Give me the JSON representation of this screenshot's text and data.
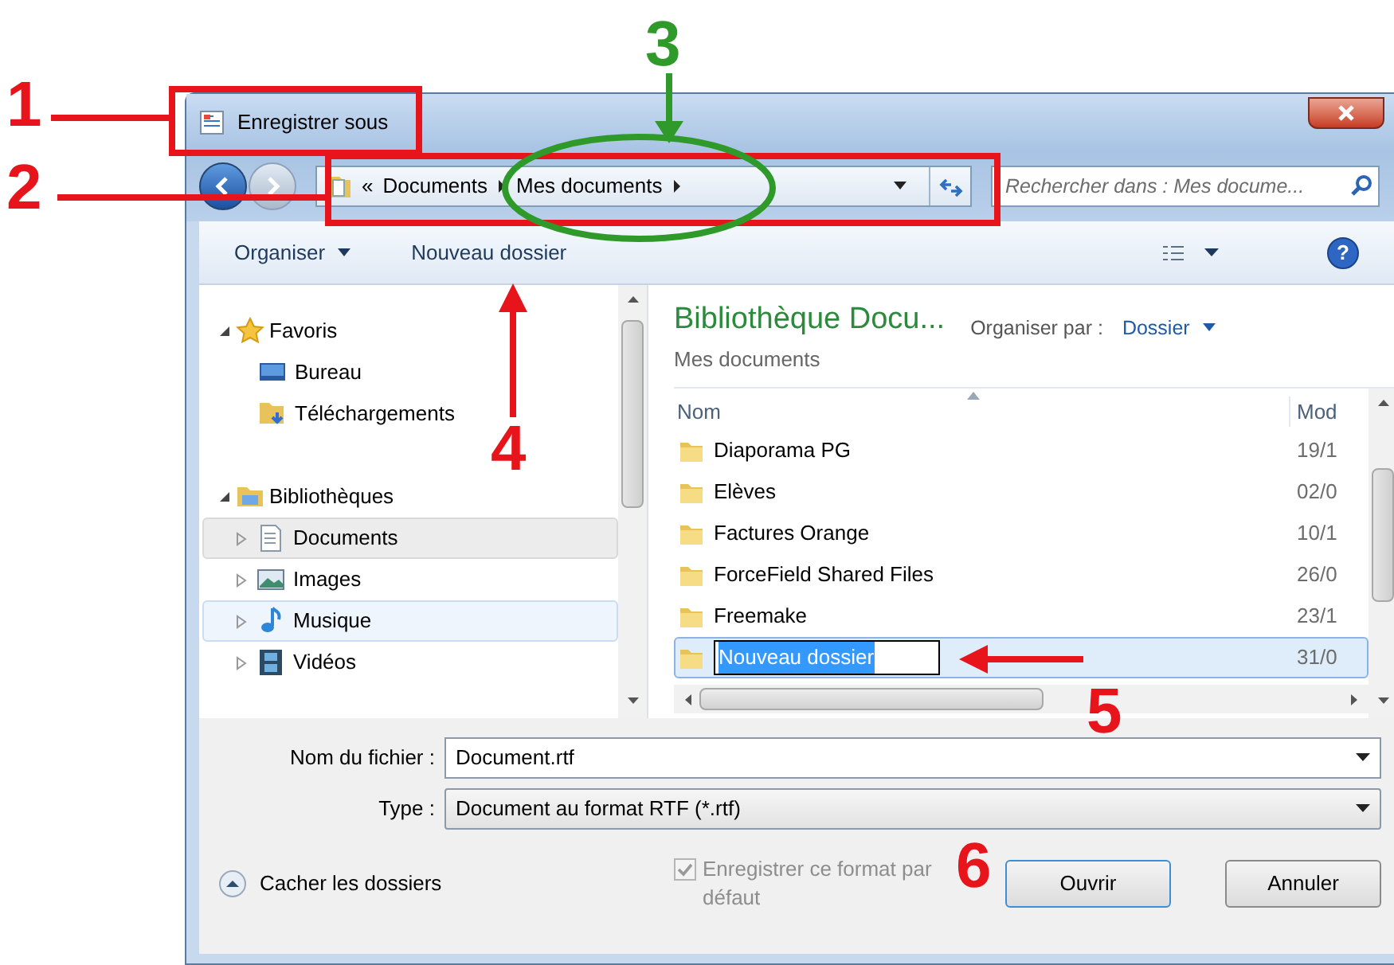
{
  "window": {
    "title": "Enregistrer sous"
  },
  "address": {
    "overflow": "«",
    "crumbs": [
      "Documents",
      "Mes documents"
    ]
  },
  "search": {
    "placeholder": "Rechercher dans : Mes docume..."
  },
  "toolbar": {
    "items": [
      "Organiser",
      "Nouveau dossier"
    ],
    "help": "?"
  },
  "navigation": [
    {
      "label": "Favoris",
      "expanded": true,
      "children": [
        {
          "label": "Bureau",
          "selected": false,
          "hovered": false
        },
        {
          "label": "Téléchargements",
          "selected": false,
          "hovered": false
        }
      ]
    },
    {
      "label": "Bibliothèques",
      "expanded": true,
      "children": [
        {
          "label": "Documents",
          "selected": true,
          "hovered": false
        },
        {
          "label": "Images",
          "selected": false,
          "hovered": false
        },
        {
          "label": "Musique",
          "selected": false,
          "hovered": true
        },
        {
          "label": "Vidéos",
          "selected": false,
          "hovered": false
        }
      ]
    }
  ],
  "library": {
    "title": "Bibliothèque Docu...",
    "subtitle": "Mes documents",
    "arrange_label": "Organiser par :",
    "arrange_value": "Dossier"
  },
  "columns": [
    "Nom",
    "Mod"
  ],
  "files": [
    {
      "name": "Diaporama PG",
      "modified": "19/1",
      "selected": false,
      "editing": false
    },
    {
      "name": "Elèves",
      "modified": "02/0",
      "selected": false,
      "editing": false
    },
    {
      "name": "Factures Orange",
      "modified": "10/1",
      "selected": false,
      "editing": false
    },
    {
      "name": "ForceField Shared Files",
      "modified": "26/0",
      "selected": false,
      "editing": false
    },
    {
      "name": "Freemake",
      "modified": "23/1",
      "selected": false,
      "editing": false
    },
    {
      "name": "Nouveau dossier",
      "modified": "31/0",
      "selected": true,
      "editing": true
    }
  ],
  "filename": {
    "label": "Nom du fichier :",
    "value": "Document.rtf"
  },
  "filetype": {
    "label": "Type :",
    "value": "Document au format RTF (*.rtf)"
  },
  "save_format": {
    "label": "Enregistrer ce format par défaut",
    "checked": true,
    "disabled": true
  },
  "hide_folders": "Cacher les dossiers",
  "buttons": [
    "Ouvrir",
    "Annuler"
  ],
  "annotations": [
    {
      "label": "1",
      "color": "#e8141c"
    },
    {
      "label": "2",
      "color": "#e8141c"
    },
    {
      "label": "3",
      "color": "#2f9a2a"
    },
    {
      "label": "4",
      "color": "#e8141c"
    },
    {
      "label": "5",
      "color": "#e8141c"
    },
    {
      "label": "6",
      "color": "#e8141c"
    }
  ]
}
